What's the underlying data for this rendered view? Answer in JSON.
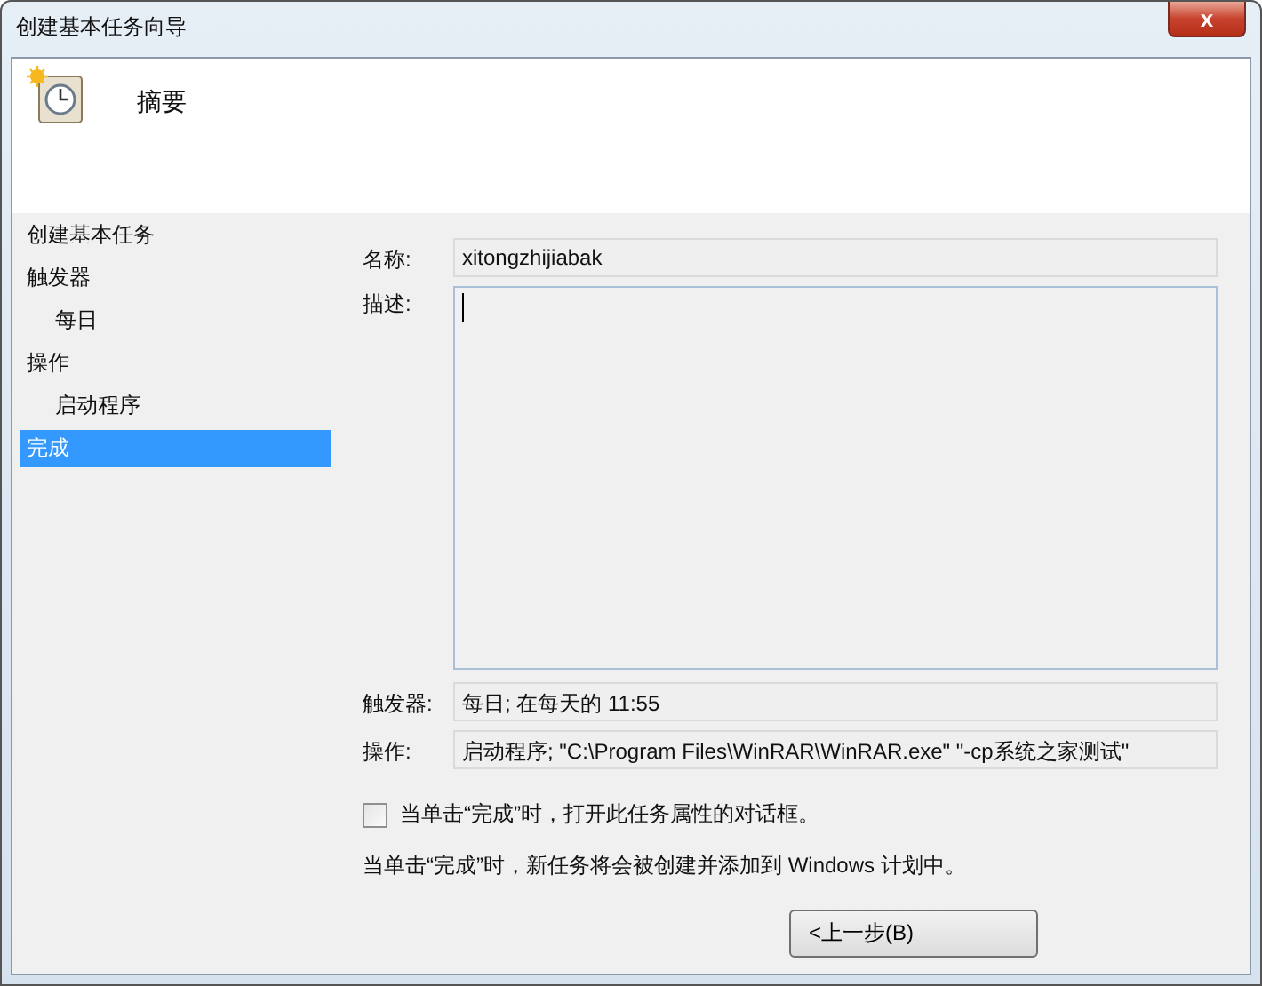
{
  "window": {
    "title": "创建基本任务向导",
    "close_label": "x"
  },
  "header": {
    "title": "摘要"
  },
  "sidebar": {
    "items": [
      {
        "label": "创建基本任务",
        "selected": false
      },
      {
        "label": "触发器",
        "selected": false,
        "children": [
          {
            "label": "每日",
            "selected": false
          }
        ]
      },
      {
        "label": "操作",
        "selected": false,
        "children": [
          {
            "label": "启动程序",
            "selected": false
          }
        ]
      },
      {
        "label": "完成",
        "selected": true
      }
    ]
  },
  "form": {
    "name": {
      "label": "名称:",
      "value": "xitongzhijiabak"
    },
    "description": {
      "label": "描述:"
    },
    "trigger": {
      "label": "触发器:",
      "value": "每日; 在每天的 11:55"
    },
    "action": {
      "label": "操作:",
      "value": "启动程序; \"C:\\Program Files\\WinRAR\\WinRAR.exe\"  \"-cp系统之家测试\""
    },
    "open_properties": {
      "label": "当单击“完成”时，打开此任务属性的对话框。",
      "checked": false
    },
    "note": "当单击“完成”时，新任务将会被创建并添加到 Windows 计划中。"
  },
  "buttons": [
    "<上一步(B)"
  ]
}
